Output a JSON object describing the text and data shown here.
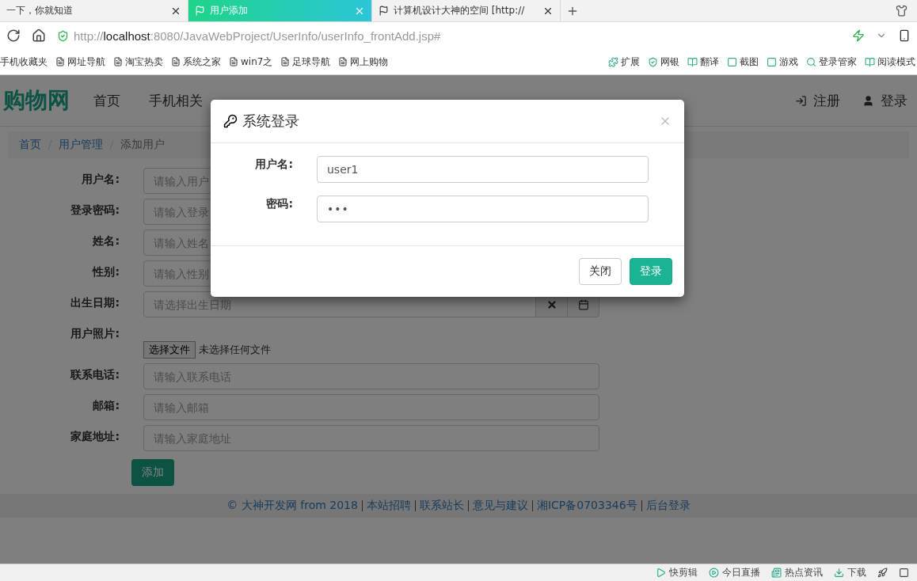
{
  "browser": {
    "tabs": [
      {
        "label": "一下，你就知道",
        "selected": false
      },
      {
        "label": "用户添加",
        "selected": true
      },
      {
        "label": "计算机设计大神的空间 [http://",
        "selected": false
      }
    ],
    "address": {
      "scheme": "http://",
      "host": "localhost",
      "rest": ":8080/JavaWebProject/UserInfo/userInfo_frontAdd.jsp#"
    },
    "bookmarks": [
      "手机收藏夹",
      "网址导航",
      "淘宝热卖",
      "系统之家",
      "win7之",
      "足球导航",
      "网上购物"
    ],
    "tools": [
      "扩展",
      "网银",
      "翻译",
      "截图",
      "游戏",
      "登录管家",
      "阅读模式"
    ]
  },
  "site": {
    "logo": "购物网",
    "nav": [
      "首页",
      "手机相关"
    ],
    "register": "注册",
    "login": "登录"
  },
  "breadcrumb": [
    "首页",
    "用户管理",
    "添加用户"
  ],
  "form": {
    "fields": [
      {
        "kind": "text",
        "label": "用户名:",
        "placeholder": "请输入用户"
      },
      {
        "kind": "text",
        "label": "登录密码:",
        "placeholder": "请输入登录"
      },
      {
        "kind": "text",
        "label": "姓名:",
        "placeholder": "请输入姓名"
      },
      {
        "kind": "text",
        "label": "性别:",
        "placeholder": "请输入性别"
      },
      {
        "kind": "date",
        "label": "出生日期:",
        "placeholder": "请选择出生日期"
      },
      {
        "kind": "file",
        "label": "用户照片:",
        "button": "选择文件",
        "status": "未选择任何文件"
      },
      {
        "kind": "text",
        "label": "联系电话:",
        "placeholder": "请输入联系电话"
      },
      {
        "kind": "text",
        "label": "邮箱:",
        "placeholder": "请输入邮箱"
      },
      {
        "kind": "text",
        "label": "家庭地址:",
        "placeholder": "请输入家庭地址"
      }
    ],
    "submit": "添加"
  },
  "footer": {
    "copyright": "© 大神开发网 from 2018",
    "links": [
      "本站招聘",
      "联系站长",
      "意见与建议",
      "湘ICP备0703346号",
      "后台登录"
    ]
  },
  "modal": {
    "title": "系统登录",
    "fields": [
      {
        "label": "用户名:",
        "value": "user1",
        "kind": "text"
      },
      {
        "label": "密码:",
        "value": "•••",
        "kind": "password"
      }
    ],
    "buttons": [
      "关闭",
      "登录"
    ]
  },
  "status_bar": [
    "快剪辑",
    "今日直播",
    "热点资讯",
    "下载"
  ]
}
